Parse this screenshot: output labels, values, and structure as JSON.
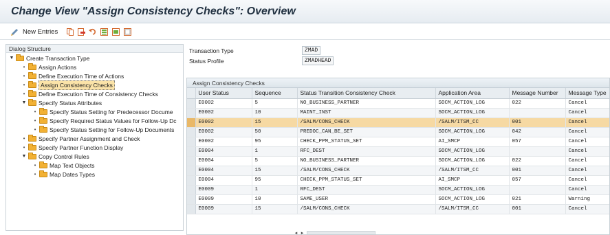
{
  "window": {
    "title": "Change View \"Assign Consistency Checks\": Overview"
  },
  "toolbar": {
    "new_entries_label": "New Entries",
    "icons": [
      "edit-glasses-icon",
      "copy-icon",
      "delete-icon",
      "undo-icon",
      "select-all-icon",
      "select-block-icon",
      "deselect-all-icon"
    ]
  },
  "dialog_structure": {
    "header": "Dialog Structure",
    "nodes": [
      {
        "label": "Create Transaction Type",
        "expanded": true
      },
      {
        "label": "Assign Actions"
      },
      {
        "label": "Define Execution Time of Actions"
      },
      {
        "label": "Assign Consistency Checks",
        "selected": true
      },
      {
        "label": "Define Execution Time of Consistency Checks"
      },
      {
        "label": "Specify Status Attributes",
        "expanded": true
      },
      {
        "label": "Specify Status Setting for Predecessor Docume"
      },
      {
        "label": "Specify Required Status Values for Follow-Up Dc"
      },
      {
        "label": "Specify Status Setting for Follow-Up Documents"
      },
      {
        "label": "Specify Partner Assignment and Check"
      },
      {
        "label": "Specify Partner Function Display"
      },
      {
        "label": "Copy Control Rules",
        "expanded": true
      },
      {
        "label": "Map Text Objects"
      },
      {
        "label": "Map Dates Types"
      }
    ]
  },
  "fields": {
    "transaction_type": {
      "label": "Transaction Type",
      "value": "ZMAD"
    },
    "status_profile": {
      "label": "Status Profile",
      "value": "ZMADHEAD"
    }
  },
  "table": {
    "caption": "Assign Consistency Checks",
    "columns": [
      "User Status",
      "Sequence",
      "Status Transition Consistency Check",
      "Application Area",
      "Message Number",
      "Message Type"
    ],
    "rows": [
      [
        "E0002",
        "5",
        "NO_BUSINESS_PARTNER",
        "SOCM_ACTION_LOG",
        "022",
        "Cancel"
      ],
      [
        "E0002",
        "10",
        "MAINT_INST",
        "SOCM_ACTION_LOG",
        "",
        "Cancel"
      ],
      [
        "E0002",
        "15",
        "/SALM/CONS_CHECK",
        "/SALM/ITSM_CC",
        "001",
        "Cancel"
      ],
      [
        "E0002",
        "50",
        "PREDOC_CAN_BE_SET",
        "SOCM_ACTION_LOG",
        "042",
        "Cancel"
      ],
      [
        "E0002",
        "95",
        "CHECK_PPM_STATUS_SET",
        "AI_SMCP",
        "057",
        "Cancel"
      ],
      [
        "E0004",
        "1",
        "RFC_DEST",
        "SOCM_ACTION_LOG",
        "",
        "Cancel"
      ],
      [
        "E0004",
        "5",
        "NO_BUSINESS_PARTNER",
        "SOCM_ACTION_LOG",
        "022",
        "Cancel"
      ],
      [
        "E0004",
        "15",
        "/SALM/CONS_CHECK",
        "/SALM/ITSM_CC",
        "001",
        "Cancel"
      ],
      [
        "E0004",
        "95",
        "CHECK_PPM_STATUS_SET",
        "AI_SMCP",
        "057",
        "Cancel"
      ],
      [
        "E0009",
        "1",
        "RFC_DEST",
        "SOCM_ACTION_LOG",
        "",
        "Cancel"
      ],
      [
        "E0009",
        "10",
        "SAME_USER",
        "SOCM_ACTION_LOG",
        "021",
        "Warning"
      ],
      [
        "E0009",
        "15",
        "/SALM/CONS_CHECK",
        "/SALM/ITSM_CC",
        "001",
        "Cancel"
      ]
    ],
    "highlighted_row": 2
  },
  "colors": {
    "highlight_row": "#f6d9a3",
    "selected_node": "#fbe3a8",
    "folder": "#f2b134"
  }
}
